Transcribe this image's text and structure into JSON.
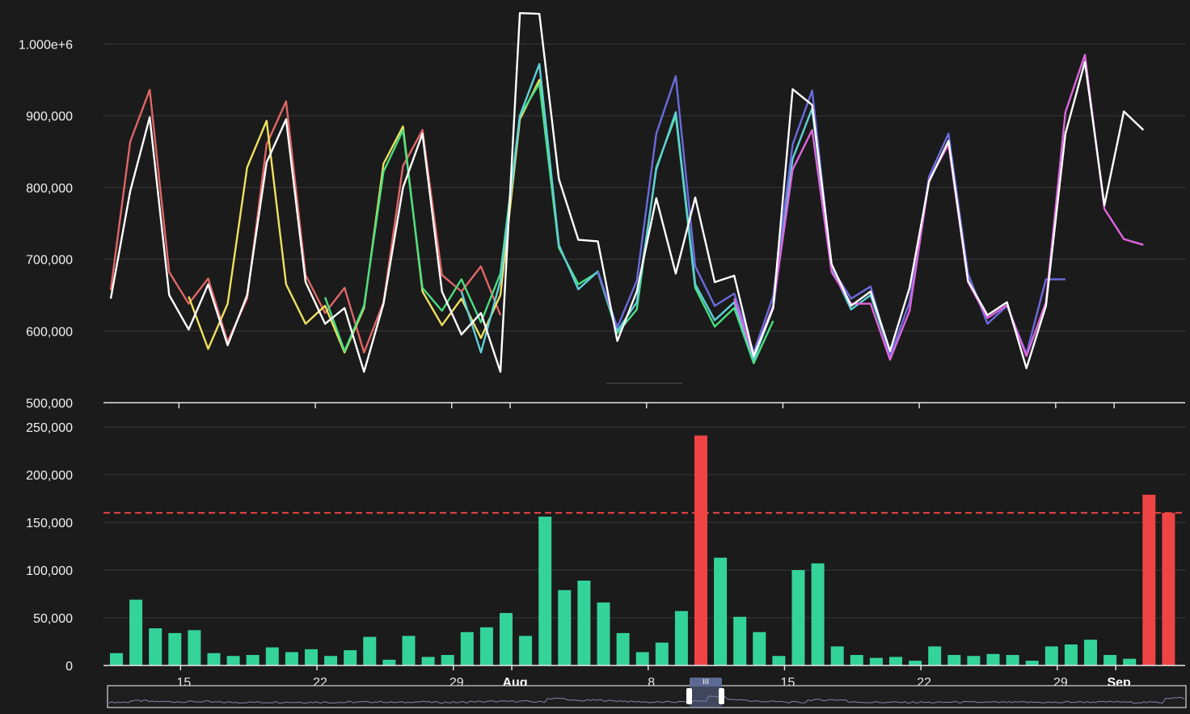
{
  "colors": {
    "background": "#1b1b1b",
    "grid": "#3a3a3a",
    "axis": "#e8e8e8",
    "bar_normal": "#34d399",
    "bar_anomaly": "#ef4444",
    "threshold": "#ef4444",
    "navigator_line": "#7c86b0"
  },
  "x_axis": {
    "start_date": "2023-07-11",
    "end_date": "2023-09-02",
    "ticks": [
      {
        "date": "2023-07-15",
        "label": "15",
        "bold": false
      },
      {
        "date": "2023-07-22",
        "label": "22",
        "bold": false
      },
      {
        "date": "2023-07-29",
        "label": "29",
        "bold": false
      },
      {
        "date": "2023-08-01",
        "label": "Aug",
        "bold": true
      },
      {
        "date": "2023-08-08",
        "label": "8",
        "bold": false
      },
      {
        "date": "2023-08-15",
        "label": "15",
        "bold": false
      },
      {
        "date": "2023-08-22",
        "label": "22",
        "bold": false
      },
      {
        "date": "2023-08-29",
        "label": "29",
        "bold": false
      },
      {
        "date": "2023-09-01",
        "label": "Sep",
        "bold": true
      }
    ]
  },
  "chart_data": [
    {
      "type": "line",
      "title": "",
      "y_ticks": [
        {
          "value": 500000,
          "label": "500,000"
        },
        {
          "value": 600000,
          "label": "600,000"
        },
        {
          "value": 700000,
          "label": "700,000"
        },
        {
          "value": 800000,
          "label": "800,000"
        },
        {
          "value": 900000,
          "label": "900,000"
        },
        {
          "value": 1000000,
          "label": "1.000e+6"
        }
      ],
      "ylim": [
        500000,
        1050000
      ],
      "grid": true,
      "series": [
        {
          "color": "#e06666",
          "x": [
            "2023-07-11",
            "2023-07-12",
            "2023-07-13",
            "2023-07-14",
            "2023-07-15",
            "2023-07-16",
            "2023-07-17",
            "2023-07-18",
            "2023-07-19",
            "2023-07-20",
            "2023-07-21",
            "2023-07-22",
            "2023-07-23",
            "2023-07-24",
            "2023-07-25",
            "2023-07-26",
            "2023-07-27",
            "2023-07-28",
            "2023-07-29",
            "2023-07-30",
            "2023-07-31"
          ],
          "y": [
            657000,
            864000,
            936000,
            682000,
            638000,
            673000,
            585000,
            645000,
            860000,
            920000,
            678000,
            625000,
            660000,
            570000,
            640000,
            830000,
            880000,
            678000,
            655000,
            690000,
            622000
          ]
        },
        {
          "color": "#f0e060",
          "x": [
            "2023-07-15",
            "2023-07-16",
            "2023-07-17",
            "2023-07-18",
            "2023-07-19",
            "2023-07-20",
            "2023-07-21",
            "2023-07-22",
            "2023-07-23",
            "2023-07-24",
            "2023-07-25",
            "2023-07-26",
            "2023-07-27",
            "2023-07-28",
            "2023-07-29",
            "2023-07-30",
            "2023-07-31",
            "2023-08-01",
            "2023-08-02",
            "2023-08-03"
          ],
          "y": [
            648000,
            575000,
            638000,
            828000,
            893000,
            665000,
            610000,
            635000,
            570000,
            632000,
            833000,
            885000,
            655000,
            608000,
            645000,
            590000,
            650000,
            895000,
            950000,
            720000
          ]
        },
        {
          "color": "#4ade80",
          "x": [
            "2023-07-22",
            "2023-07-23",
            "2023-07-24",
            "2023-07-25",
            "2023-07-26",
            "2023-07-27",
            "2023-07-28",
            "2023-07-29",
            "2023-07-30",
            "2023-07-31",
            "2023-08-01",
            "2023-08-02",
            "2023-08-03",
            "2023-08-04",
            "2023-08-05",
            "2023-08-06",
            "2023-08-07",
            "2023-08-08",
            "2023-08-09",
            "2023-08-10",
            "2023-08-11",
            "2023-08-12",
            "2023-08-13",
            "2023-08-14"
          ],
          "y": [
            647000,
            572000,
            635000,
            822000,
            880000,
            660000,
            628000,
            672000,
            612000,
            680000,
            900000,
            945000,
            716000,
            665000,
            682000,
            597000,
            630000,
            828000,
            900000,
            660000,
            606000,
            632000,
            555000,
            614000
          ]
        },
        {
          "color": "#5fd0d8",
          "x": [
            "2023-07-29",
            "2023-07-30",
            "2023-07-31",
            "2023-08-01",
            "2023-08-02",
            "2023-08-03",
            "2023-08-04",
            "2023-08-05",
            "2023-08-06",
            "2023-08-07",
            "2023-08-08",
            "2023-08-09",
            "2023-08-10",
            "2023-08-11",
            "2023-08-12",
            "2023-08-13",
            "2023-08-14",
            "2023-08-15",
            "2023-08-16",
            "2023-08-17",
            "2023-08-18",
            "2023-08-19",
            "2023-08-20"
          ],
          "y": [
            655000,
            570000,
            670000,
            900000,
            972000,
            720000,
            658000,
            683000,
            600000,
            640000,
            825000,
            905000,
            665000,
            615000,
            640000,
            560000,
            632000,
            840000,
            910000,
            688000,
            630000,
            650000,
            568000
          ]
        },
        {
          "color": "#6b6bdd",
          "x": [
            "2023-08-05",
            "2023-08-06",
            "2023-08-07",
            "2023-08-08",
            "2023-08-09",
            "2023-08-10",
            "2023-08-11",
            "2023-08-12",
            "2023-08-13",
            "2023-08-14",
            "2023-08-15",
            "2023-08-16",
            "2023-08-17",
            "2023-08-18",
            "2023-08-19",
            "2023-08-20",
            "2023-08-21",
            "2023-08-22",
            "2023-08-23",
            "2023-08-24",
            "2023-08-25",
            "2023-08-26",
            "2023-08-27",
            "2023-08-28",
            "2023-08-29"
          ],
          "y": [
            683000,
            605000,
            670000,
            875000,
            955000,
            690000,
            635000,
            652000,
            570000,
            648000,
            860000,
            935000,
            688000,
            645000,
            662000,
            565000,
            640000,
            815000,
            875000,
            680000,
            610000,
            635000,
            568000,
            672000,
            672000
          ]
        },
        {
          "color": "#dd66dd",
          "x": [
            "2023-08-12",
            "2023-08-13",
            "2023-08-14",
            "2023-08-15",
            "2023-08-16",
            "2023-08-17",
            "2023-08-18",
            "2023-08-19",
            "2023-08-20",
            "2023-08-21",
            "2023-08-22",
            "2023-08-23",
            "2023-08-24",
            "2023-08-25",
            "2023-08-26",
            "2023-08-27",
            "2023-08-28",
            "2023-08-29",
            "2023-08-30",
            "2023-08-31",
            "2023-09-01",
            "2023-09-02"
          ],
          "y": [
            645000,
            565000,
            635000,
            825000,
            880000,
            682000,
            638000,
            638000,
            560000,
            628000,
            810000,
            860000,
            668000,
            618000,
            636000,
            565000,
            640000,
            905000,
            985000,
            770000,
            728000,
            720000
          ]
        },
        {
          "color": "#ffffff",
          "x": [
            "2023-07-11",
            "2023-07-12",
            "2023-07-13",
            "2023-07-14",
            "2023-07-15",
            "2023-07-16",
            "2023-07-17",
            "2023-07-18",
            "2023-07-19",
            "2023-07-20",
            "2023-07-21",
            "2023-07-22",
            "2023-07-23",
            "2023-07-24",
            "2023-07-25",
            "2023-07-26",
            "2023-07-27",
            "2023-07-28",
            "2023-07-29",
            "2023-07-30",
            "2023-07-31",
            "2023-08-01",
            "2023-08-02",
            "2023-08-03",
            "2023-08-04",
            "2023-08-05",
            "2023-08-06",
            "2023-08-07",
            "2023-08-08",
            "2023-08-09",
            "2023-08-10",
            "2023-08-11",
            "2023-08-12",
            "2023-08-13",
            "2023-08-14",
            "2023-08-15",
            "2023-08-16",
            "2023-08-17",
            "2023-08-18",
            "2023-08-19",
            "2023-08-20",
            "2023-08-21",
            "2023-08-22",
            "2023-08-23",
            "2023-08-24",
            "2023-08-25",
            "2023-08-26",
            "2023-08-27",
            "2023-08-28",
            "2023-08-29",
            "2023-08-30",
            "2023-08-31",
            "2023-09-01",
            "2023-09-02"
          ],
          "y": [
            645000,
            795000,
            898000,
            650000,
            602000,
            665000,
            580000,
            650000,
            835000,
            895000,
            668000,
            610000,
            632000,
            543000,
            638000,
            800000,
            875000,
            655000,
            595000,
            625000,
            543000,
            1043000,
            1042000,
            812000,
            727000,
            725000,
            586000,
            655000,
            785000,
            680000,
            786000,
            668000,
            677000,
            565000,
            632000,
            937000,
            915000,
            693000,
            635000,
            655000,
            572000,
            660000,
            808000,
            865000,
            670000,
            622000,
            640000,
            548000,
            635000,
            875000,
            975000,
            775000,
            906000,
            880000
          ]
        }
      ]
    },
    {
      "type": "bar",
      "title": "",
      "y_ticks": [
        {
          "value": 0,
          "label": "0"
        },
        {
          "value": 50000,
          "label": "50,000"
        },
        {
          "value": 100000,
          "label": "100,000"
        },
        {
          "value": 150000,
          "label": "150,000"
        },
        {
          "value": 200000,
          "label": "200,000"
        },
        {
          "value": 250000,
          "label": "250,000"
        }
      ],
      "ylim": [
        0,
        250000
      ],
      "threshold": 160000,
      "grid": true,
      "x": [
        "2023-07-11",
        "2023-07-12",
        "2023-07-13",
        "2023-07-14",
        "2023-07-15",
        "2023-07-16",
        "2023-07-17",
        "2023-07-18",
        "2023-07-19",
        "2023-07-20",
        "2023-07-21",
        "2023-07-22",
        "2023-07-23",
        "2023-07-24",
        "2023-07-25",
        "2023-07-26",
        "2023-07-27",
        "2023-07-28",
        "2023-07-29",
        "2023-07-30",
        "2023-07-31",
        "2023-08-01",
        "2023-08-02",
        "2023-08-03",
        "2023-08-04",
        "2023-08-05",
        "2023-08-06",
        "2023-08-07",
        "2023-08-08",
        "2023-08-09",
        "2023-08-10",
        "2023-08-11",
        "2023-08-12",
        "2023-08-13",
        "2023-08-14",
        "2023-08-15",
        "2023-08-16",
        "2023-08-17",
        "2023-08-18",
        "2023-08-19",
        "2023-08-20",
        "2023-08-21",
        "2023-08-22",
        "2023-08-23",
        "2023-08-24",
        "2023-08-25",
        "2023-08-26",
        "2023-08-27",
        "2023-08-28",
        "2023-08-29",
        "2023-08-30",
        "2023-08-31",
        "2023-09-01",
        "2023-09-02"
      ],
      "values": [
        13000,
        69000,
        39000,
        34000,
        37000,
        13000,
        10000,
        11000,
        19000,
        14000,
        17000,
        10000,
        16000,
        30000,
        6000,
        31000,
        9000,
        11000,
        35000,
        40000,
        55000,
        31000,
        156000,
        79000,
        89000,
        66000,
        34000,
        14000,
        24000,
        57000,
        241000,
        113000,
        51000,
        35000,
        10000,
        100000,
        107000,
        20000,
        11000,
        8000,
        9000,
        5000,
        20000,
        11000,
        10000,
        12000,
        11000,
        5000,
        20000,
        22000,
        27000,
        11000,
        7000,
        179000,
        160000
      ],
      "anomaly": [
        false,
        false,
        false,
        false,
        false,
        false,
        false,
        false,
        false,
        false,
        false,
        false,
        false,
        false,
        false,
        false,
        false,
        false,
        false,
        false,
        false,
        false,
        false,
        false,
        false,
        false,
        false,
        false,
        false,
        false,
        true,
        false,
        false,
        false,
        false,
        false,
        false,
        false,
        false,
        false,
        false,
        false,
        false,
        false,
        false,
        false,
        false,
        false,
        false,
        false,
        false,
        false,
        false,
        true,
        true
      ]
    }
  ]
}
